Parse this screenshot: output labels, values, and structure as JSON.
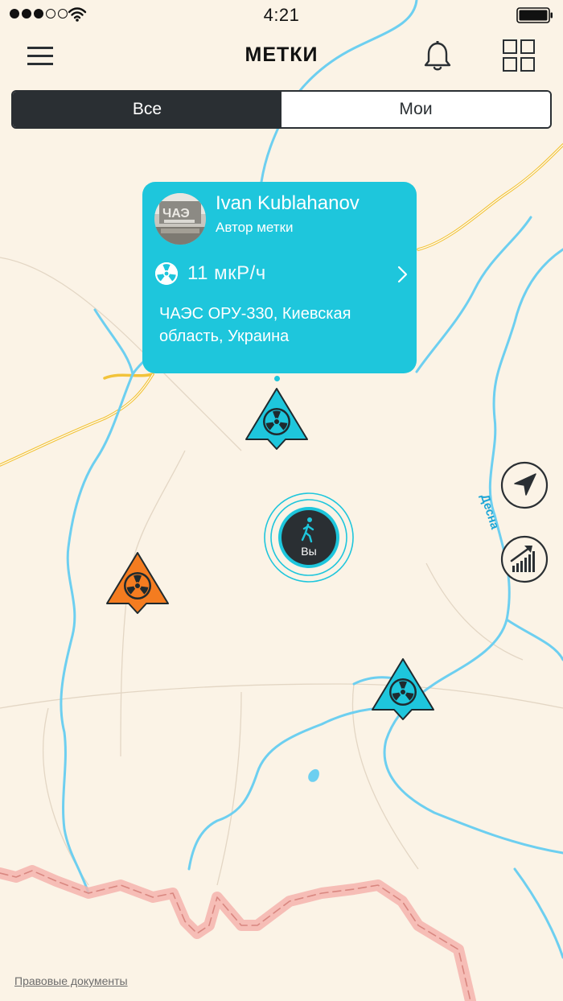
{
  "status_bar": {
    "time": "4:21",
    "signal_dots_filled": 3,
    "signal_dots_total": 5
  },
  "nav": {
    "title": "МЕТКИ"
  },
  "tabs": {
    "all": "Все",
    "mine": "Мои",
    "selected": "all"
  },
  "popup": {
    "author_name": "Ivan Kublahanov",
    "author_role": "Автор метки",
    "reading": "11 мкР/ч",
    "address": "ЧАЭС ОРУ-330, Киевская область, Украина"
  },
  "map": {
    "user_marker_label": "Вы",
    "river_label": "Десна",
    "legal_link": "Правовые документы"
  },
  "colors": {
    "accent": "#1ec6dc",
    "dark": "#2a2f33",
    "warning_marker": "#f47c20",
    "map_background": "#fbf3e6",
    "river": "#6dcff0",
    "road": "#f2c33a",
    "border": "#f4b3ad"
  },
  "icons": {
    "menu": "hamburger-menu-icon",
    "notifications": "bell-icon",
    "grid": "grid-icon",
    "radiation": "radiation-icon",
    "walking": "walking-person-icon",
    "locate": "navigation-arrow-icon",
    "stats": "rising-chart-icon"
  }
}
